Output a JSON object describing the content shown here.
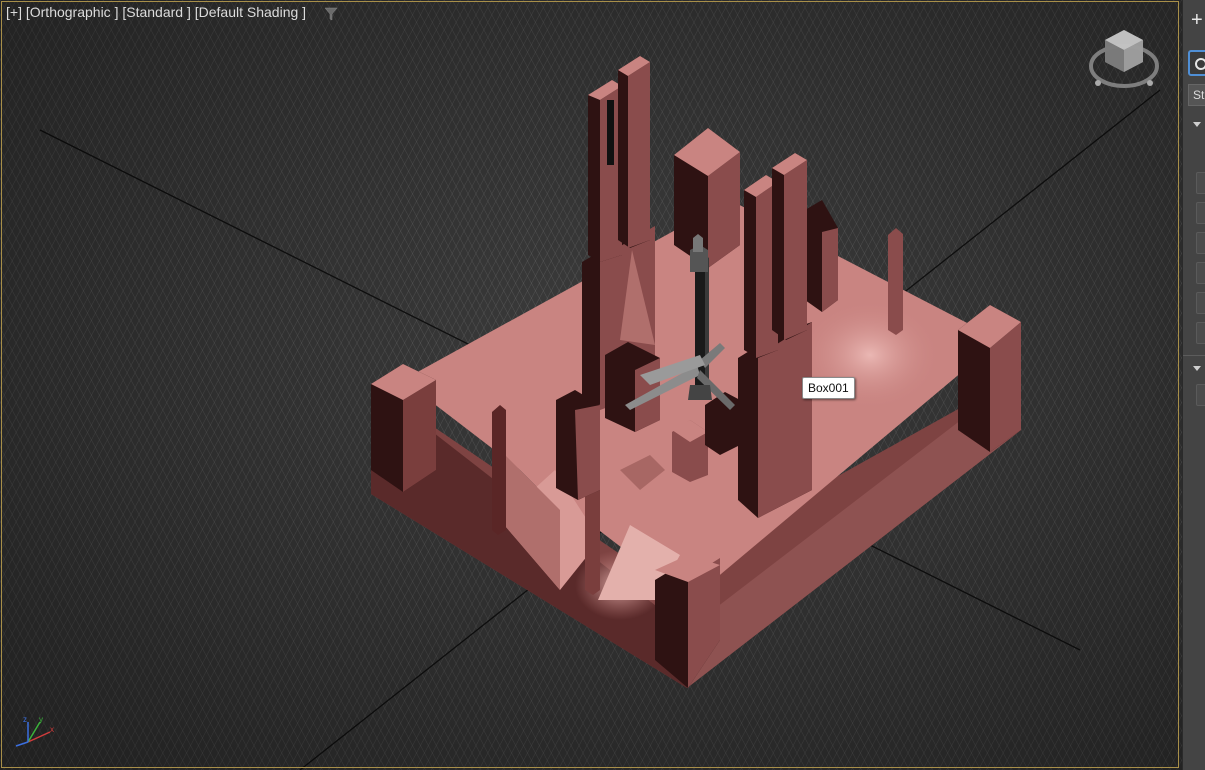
{
  "viewport": {
    "labels": [
      "[+]",
      "[Orthographic ]",
      "[Standard ]",
      "[Default Shading ]"
    ],
    "tooltip": "Box001",
    "axis": {
      "x": "x",
      "y": "y",
      "z": "z"
    }
  },
  "side_panel": {
    "create_label": "+",
    "tab_label": "St"
  },
  "colors": {
    "viewport_bg": "#3c3c3c",
    "model_top": "#c98481",
    "model_side_light": "#8a4c4c",
    "model_side_dark": "#2e1212",
    "viewport_border": "#a88f49",
    "panel_accent": "#4f8fd6"
  }
}
